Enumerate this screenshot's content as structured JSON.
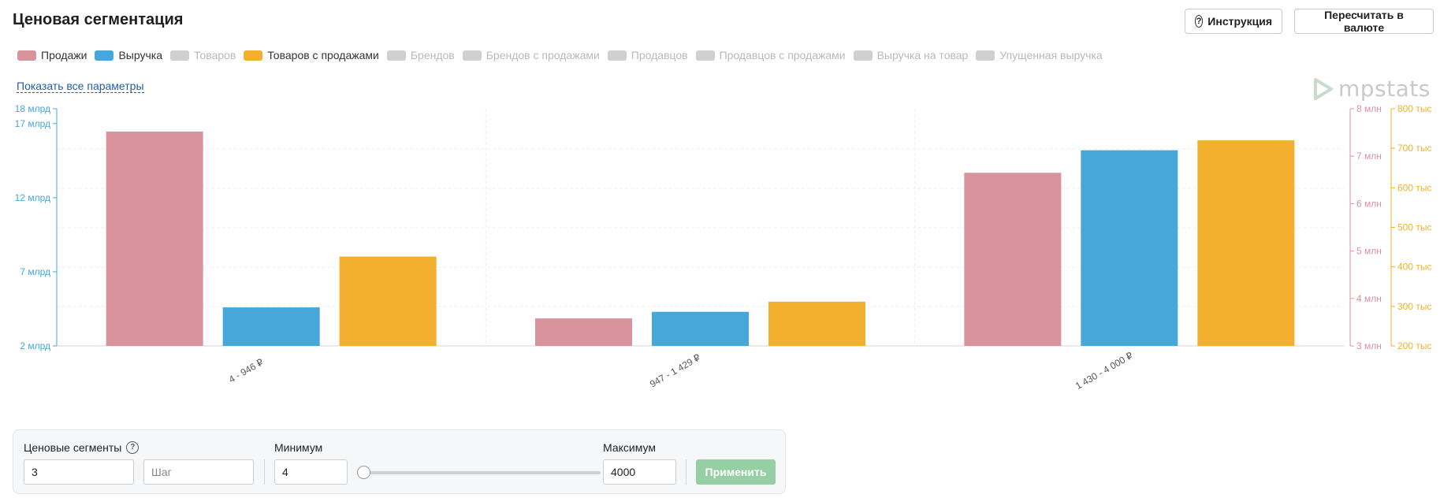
{
  "header": {
    "title": "Ценовая сегментация",
    "instructions_label": "Инструкция",
    "recalc_label": "Пересчитать в валюте"
  },
  "legend": [
    {
      "label": "Продажи",
      "color": "#d9939d",
      "active": true
    },
    {
      "label": "Выручка",
      "color": "#47a7d8",
      "active": true
    },
    {
      "label": "Товаров",
      "color": "#cfcfcf",
      "active": false
    },
    {
      "label": "Товаров с продажами",
      "color": "#f2b02e",
      "active": true
    },
    {
      "label": "Брендов",
      "color": "#cfcfcf",
      "active": false
    },
    {
      "label": "Брендов с продажами",
      "color": "#cfcfcf",
      "active": false
    },
    {
      "label": "Продавцов",
      "color": "#cfcfcf",
      "active": false
    },
    {
      "label": "Продавцов с продажами",
      "color": "#cfcfcf",
      "active": false
    },
    {
      "label": "Выручка на товар",
      "color": "#cfcfcf",
      "active": false
    },
    {
      "label": "Упущенная выручка",
      "color": "#cfcfcf",
      "active": false
    }
  ],
  "show_all_label": "Показать все параметры",
  "logo_text": "mpstats",
  "chart_data": {
    "type": "bar",
    "categories": [
      "4 - 946 ₽",
      "947 - 1 429 ₽",
      "1 430 - 4 000 ₽"
    ],
    "series": [
      {
        "name": "Продажи",
        "color": "#d9939d",
        "axis": "right1",
        "values": [
          7.52,
          3.58,
          6.65
        ]
      },
      {
        "name": "Выручка",
        "color": "#47a7d8",
        "axis": "left",
        "values": [
          4.6,
          4.3,
          15.2
        ]
      },
      {
        "name": "Товаров с продажами",
        "color": "#f2b02e",
        "axis": "right2",
        "values": [
          426,
          312,
          720
        ]
      }
    ],
    "axes": {
      "left": {
        "min": 2,
        "max": 18,
        "color": "#47a7d8",
        "ticks": [
          {
            "v": 2,
            "label": "2 млрд"
          },
          {
            "v": 7,
            "label": "7 млрд"
          },
          {
            "v": 12,
            "label": "12 млрд"
          },
          {
            "v": 17,
            "label": "17 млрд"
          },
          {
            "v": 18,
            "label": "18 млрд"
          }
        ]
      },
      "right1": {
        "min": 3,
        "max": 8,
        "color": "#d9939d",
        "ticks": [
          {
            "v": 3,
            "label": "3 млн"
          },
          {
            "v": 4,
            "label": "4 млн"
          },
          {
            "v": 5,
            "label": "5 млн"
          },
          {
            "v": 6,
            "label": "6 млн"
          },
          {
            "v": 7,
            "label": "7 млн"
          },
          {
            "v": 8,
            "label": "8 млн"
          }
        ]
      },
      "right2": {
        "min": 200,
        "max": 800,
        "color": "#f2b02e",
        "ticks": [
          {
            "v": 200,
            "label": "200 тыс"
          },
          {
            "v": 300,
            "label": "300 тыс"
          },
          {
            "v": 400,
            "label": "400 тыс"
          },
          {
            "v": 500,
            "label": "500 тыс"
          },
          {
            "v": 600,
            "label": "600 тыс"
          },
          {
            "v": 700,
            "label": "700 тыс"
          },
          {
            "v": 800,
            "label": "800 тыс"
          }
        ]
      }
    },
    "grid": true
  },
  "controls": {
    "segments_label": "Ценовые сегменты",
    "segments_value": "3",
    "step_placeholder": "Шаг",
    "min_label": "Минимум",
    "min_value": "4",
    "max_label": "Максимум",
    "max_value": "4000",
    "slider_value": 0,
    "apply_label": "Применить"
  }
}
